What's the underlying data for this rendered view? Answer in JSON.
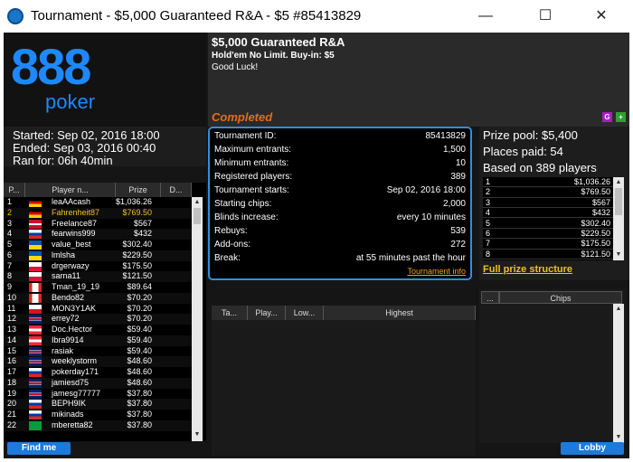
{
  "window": {
    "title": "Tournament - $5,000 Guaranteed R&A  - $5 #85413829",
    "minimize": "—",
    "maximize": "☐",
    "close": "✕"
  },
  "logo": {
    "line1": "888",
    "line2": "poker"
  },
  "header": {
    "name": "$5,000 Guaranteed R&A",
    "game": "Hold'em No Limit. Buy-in: $5",
    "message": "Good Luck!",
    "status": "Completed",
    "g_button": "G",
    "plus_button": "+"
  },
  "times": {
    "started": "Started: Sep 02, 2016 18:00",
    "ended": "Ended: Sep 03, 2016 00:40",
    "ran_for": "Ran for: 06h 40min"
  },
  "info": {
    "rows": [
      {
        "label": "Tournament ID:",
        "value": "85413829"
      },
      {
        "label": "Maximum entrants:",
        "value": "1,500"
      },
      {
        "label": "Minimum entrants:",
        "value": "10"
      },
      {
        "label": "Registered players:",
        "value": "389"
      },
      {
        "label": "Tournament starts:",
        "value": "Sep 02, 2016 18:00"
      },
      {
        "label": "Starting chips:",
        "value": "2,000"
      },
      {
        "label": "Blinds increase:",
        "value": "every 10 minutes"
      },
      {
        "label": "Rebuys:",
        "value": "539"
      },
      {
        "label": "Add-ons:",
        "value": "272"
      },
      {
        "label": "Break:",
        "value": "at 55 minutes past the hour"
      }
    ],
    "link": "Tournament info"
  },
  "prize": {
    "pool": "Prize pool: $5,400",
    "places": "Places paid: 54",
    "based": "Based on 389 players",
    "rows": [
      {
        "place": "1",
        "amount": "$1,036.26"
      },
      {
        "place": "2",
        "amount": "$769.50"
      },
      {
        "place": "3",
        "amount": "$567"
      },
      {
        "place": "4",
        "amount": "$432"
      },
      {
        "place": "5",
        "amount": "$302.40"
      },
      {
        "place": "6",
        "amount": "$229.50"
      },
      {
        "place": "7",
        "amount": "$175.50"
      },
      {
        "place": "8",
        "amount": "$121.50"
      }
    ],
    "full_link": "Full prize structure"
  },
  "players": {
    "headers": [
      "P...",
      "Player n...",
      "Prize",
      "D..."
    ],
    "rows": [
      {
        "rank": "1",
        "name": "leaAAcash",
        "prize": "$1,036.26",
        "flag": "de"
      },
      {
        "rank": "2",
        "name": "Fahrenheit87",
        "prize": "$769.50",
        "flag": "de"
      },
      {
        "rank": "3",
        "name": "Freelance87",
        "prize": "$567",
        "flag": "dk"
      },
      {
        "rank": "4",
        "name": "fearwins999",
        "prize": "$432",
        "flag": "ru"
      },
      {
        "rank": "5",
        "name": "value_best",
        "prize": "$302.40",
        "flag": "ua"
      },
      {
        "rank": "6",
        "name": "lmlsha",
        "prize": "$229.50",
        "flag": "ua"
      },
      {
        "rank": "7",
        "name": "drgerwazy",
        "prize": "$175.50",
        "flag": "pl"
      },
      {
        "rank": "8",
        "name": "sarna11",
        "prize": "$121.50",
        "flag": "pl"
      },
      {
        "rank": "9",
        "name": "Tman_19_19",
        "prize": "$89.64",
        "flag": "ca"
      },
      {
        "rank": "10",
        "name": "Bendo82",
        "prize": "$70.20",
        "flag": "ca"
      },
      {
        "rank": "11",
        "name": "MON3Y1AK",
        "prize": "$70.20",
        "flag": "cz"
      },
      {
        "rank": "12",
        "name": "errey72",
        "prize": "$70.20",
        "flag": "gb"
      },
      {
        "rank": "13",
        "name": "Doc.Hector",
        "prize": "$59.40",
        "flag": "at"
      },
      {
        "rank": "14",
        "name": "Ibra9914",
        "prize": "$59.40",
        "flag": "at"
      },
      {
        "rank": "15",
        "name": "rasiak",
        "prize": "$59.40",
        "flag": "gb"
      },
      {
        "rank": "16",
        "name": "weeklystorm",
        "prize": "$48.60",
        "flag": "gb"
      },
      {
        "rank": "17",
        "name": "pokerday171",
        "prize": "$48.60",
        "flag": "ru"
      },
      {
        "rank": "18",
        "name": "jamiesd75",
        "prize": "$48.60",
        "flag": "gb"
      },
      {
        "rank": "19",
        "name": "jamesg77777",
        "prize": "$37.80",
        "flag": "gb"
      },
      {
        "rank": "20",
        "name": "BEPH9IK",
        "prize": "$37.80",
        "flag": "ru"
      },
      {
        "rank": "21",
        "name": "mikinads",
        "prize": "$37.80",
        "flag": "ru"
      },
      {
        "rank": "22",
        "name": "mberetta82",
        "prize": "$37.80",
        "flag": "br"
      }
    ],
    "find_me": "Find me"
  },
  "tables": {
    "headers": [
      "Ta...",
      "Play...",
      "Low...",
      "Highest"
    ]
  },
  "chips": {
    "headers": [
      "...",
      "Chips"
    ]
  },
  "lobby": "Lobby",
  "colors": {
    "accent": "#1e7ad8",
    "completed": "#e86c1a",
    "highlight": "#f0c020"
  }
}
